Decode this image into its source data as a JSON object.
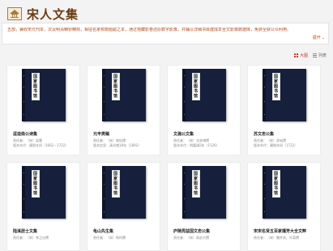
{
  "header": {
    "site_title": "宋人文集"
  },
  "intro": {
    "text": "五部，兼收宋元刊本，次及明清精钞精刻，相征名家校勘题跋之本，通过馆藏影卷还原数字影像，并辅以详细书目建成本全文影像数据库，免费至获公众利用。",
    "expand_label": "展开"
  },
  "view": {
    "grid_label": "大图",
    "list_label": "列表"
  },
  "books": [
    {
      "label_chars": [
        "国",
        "家",
        "图",
        "书",
        "馆"
      ],
      "title": "逗造斋公诗集",
      "author": "责任者：（宋）梁灏",
      "edition": "版本年代：康熙年间（1662－1722）"
    },
    {
      "label_chars": [
        "国",
        "家",
        "图",
        "书",
        "馆"
      ],
      "title": "元丰类稿",
      "author": "责任者：（宋）曾巩撰",
      "edition": "版本信息：清光绪18年（1892）"
    },
    {
      "label_chars": [
        "国",
        "家",
        "图",
        "书",
        "馆"
      ],
      "title": "文潞公文集",
      "author": "责任者：（宋）文彦博撰",
      "edition": "版本年代：明嘉靖5年（1526）"
    },
    {
      "label_chars": [
        "国",
        "家",
        "图",
        "书",
        "馆"
      ],
      "title": "苏文忠公集",
      "author": "责任者：（宋）苏轼撰",
      "edition": "版本年代：康熙年间（1722）"
    },
    {
      "label_chars": [
        "国",
        "家",
        "图",
        "书",
        "馆"
      ],
      "title": "陆溪居士文集",
      "author": "责任者：（宋）李之仪撰",
      "edition": ""
    },
    {
      "label_chars": [
        "国",
        "家",
        "图",
        "书",
        "馆"
      ],
      "title": "龟山先生集",
      "author": "责任者：（宋）杨时撰",
      "edition": ""
    },
    {
      "label_chars": [
        "国",
        "家",
        "图",
        "书",
        "馆"
      ],
      "title": "庐陵周益国文忠公集",
      "author": "责任者：（宋）周必大撰",
      "edition": ""
    },
    {
      "label_chars": [
        "国",
        "家",
        "图",
        "书",
        "馆"
      ],
      "title": "宋宋名贤五百家播芳大全文粹",
      "author": "责任者：（宋）魏齐贤，叶菜撰",
      "edition": ""
    }
  ]
}
